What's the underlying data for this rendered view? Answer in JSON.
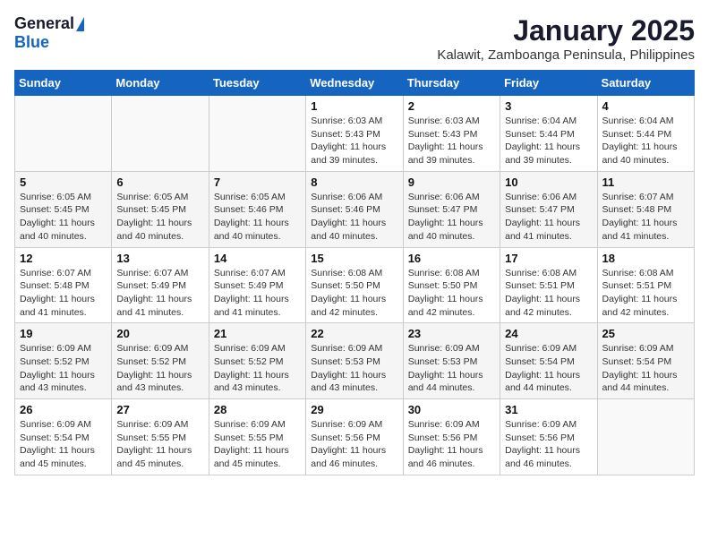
{
  "logo": {
    "general": "General",
    "blue": "Blue"
  },
  "title": "January 2025",
  "subtitle": "Kalawit, Zamboanga Peninsula, Philippines",
  "days_of_week": [
    "Sunday",
    "Monday",
    "Tuesday",
    "Wednesday",
    "Thursday",
    "Friday",
    "Saturday"
  ],
  "weeks": [
    [
      {
        "day": "",
        "content": ""
      },
      {
        "day": "",
        "content": ""
      },
      {
        "day": "",
        "content": ""
      },
      {
        "day": "1",
        "content": "Sunrise: 6:03 AM\nSunset: 5:43 PM\nDaylight: 11 hours\nand 39 minutes."
      },
      {
        "day": "2",
        "content": "Sunrise: 6:03 AM\nSunset: 5:43 PM\nDaylight: 11 hours\nand 39 minutes."
      },
      {
        "day": "3",
        "content": "Sunrise: 6:04 AM\nSunset: 5:44 PM\nDaylight: 11 hours\nand 39 minutes."
      },
      {
        "day": "4",
        "content": "Sunrise: 6:04 AM\nSunset: 5:44 PM\nDaylight: 11 hours\nand 40 minutes."
      }
    ],
    [
      {
        "day": "5",
        "content": "Sunrise: 6:05 AM\nSunset: 5:45 PM\nDaylight: 11 hours\nand 40 minutes."
      },
      {
        "day": "6",
        "content": "Sunrise: 6:05 AM\nSunset: 5:45 PM\nDaylight: 11 hours\nand 40 minutes."
      },
      {
        "day": "7",
        "content": "Sunrise: 6:05 AM\nSunset: 5:46 PM\nDaylight: 11 hours\nand 40 minutes."
      },
      {
        "day": "8",
        "content": "Sunrise: 6:06 AM\nSunset: 5:46 PM\nDaylight: 11 hours\nand 40 minutes."
      },
      {
        "day": "9",
        "content": "Sunrise: 6:06 AM\nSunset: 5:47 PM\nDaylight: 11 hours\nand 40 minutes."
      },
      {
        "day": "10",
        "content": "Sunrise: 6:06 AM\nSunset: 5:47 PM\nDaylight: 11 hours\nand 41 minutes."
      },
      {
        "day": "11",
        "content": "Sunrise: 6:07 AM\nSunset: 5:48 PM\nDaylight: 11 hours\nand 41 minutes."
      }
    ],
    [
      {
        "day": "12",
        "content": "Sunrise: 6:07 AM\nSunset: 5:48 PM\nDaylight: 11 hours\nand 41 minutes."
      },
      {
        "day": "13",
        "content": "Sunrise: 6:07 AM\nSunset: 5:49 PM\nDaylight: 11 hours\nand 41 minutes."
      },
      {
        "day": "14",
        "content": "Sunrise: 6:07 AM\nSunset: 5:49 PM\nDaylight: 11 hours\nand 41 minutes."
      },
      {
        "day": "15",
        "content": "Sunrise: 6:08 AM\nSunset: 5:50 PM\nDaylight: 11 hours\nand 42 minutes."
      },
      {
        "day": "16",
        "content": "Sunrise: 6:08 AM\nSunset: 5:50 PM\nDaylight: 11 hours\nand 42 minutes."
      },
      {
        "day": "17",
        "content": "Sunrise: 6:08 AM\nSunset: 5:51 PM\nDaylight: 11 hours\nand 42 minutes."
      },
      {
        "day": "18",
        "content": "Sunrise: 6:08 AM\nSunset: 5:51 PM\nDaylight: 11 hours\nand 42 minutes."
      }
    ],
    [
      {
        "day": "19",
        "content": "Sunrise: 6:09 AM\nSunset: 5:52 PM\nDaylight: 11 hours\nand 43 minutes."
      },
      {
        "day": "20",
        "content": "Sunrise: 6:09 AM\nSunset: 5:52 PM\nDaylight: 11 hours\nand 43 minutes."
      },
      {
        "day": "21",
        "content": "Sunrise: 6:09 AM\nSunset: 5:52 PM\nDaylight: 11 hours\nand 43 minutes."
      },
      {
        "day": "22",
        "content": "Sunrise: 6:09 AM\nSunset: 5:53 PM\nDaylight: 11 hours\nand 43 minutes."
      },
      {
        "day": "23",
        "content": "Sunrise: 6:09 AM\nSunset: 5:53 PM\nDaylight: 11 hours\nand 44 minutes."
      },
      {
        "day": "24",
        "content": "Sunrise: 6:09 AM\nSunset: 5:54 PM\nDaylight: 11 hours\nand 44 minutes."
      },
      {
        "day": "25",
        "content": "Sunrise: 6:09 AM\nSunset: 5:54 PM\nDaylight: 11 hours\nand 44 minutes."
      }
    ],
    [
      {
        "day": "26",
        "content": "Sunrise: 6:09 AM\nSunset: 5:54 PM\nDaylight: 11 hours\nand 45 minutes."
      },
      {
        "day": "27",
        "content": "Sunrise: 6:09 AM\nSunset: 5:55 PM\nDaylight: 11 hours\nand 45 minutes."
      },
      {
        "day": "28",
        "content": "Sunrise: 6:09 AM\nSunset: 5:55 PM\nDaylight: 11 hours\nand 45 minutes."
      },
      {
        "day": "29",
        "content": "Sunrise: 6:09 AM\nSunset: 5:56 PM\nDaylight: 11 hours\nand 46 minutes."
      },
      {
        "day": "30",
        "content": "Sunrise: 6:09 AM\nSunset: 5:56 PM\nDaylight: 11 hours\nand 46 minutes."
      },
      {
        "day": "31",
        "content": "Sunrise: 6:09 AM\nSunset: 5:56 PM\nDaylight: 11 hours\nand 46 minutes."
      },
      {
        "day": "",
        "content": ""
      }
    ]
  ]
}
